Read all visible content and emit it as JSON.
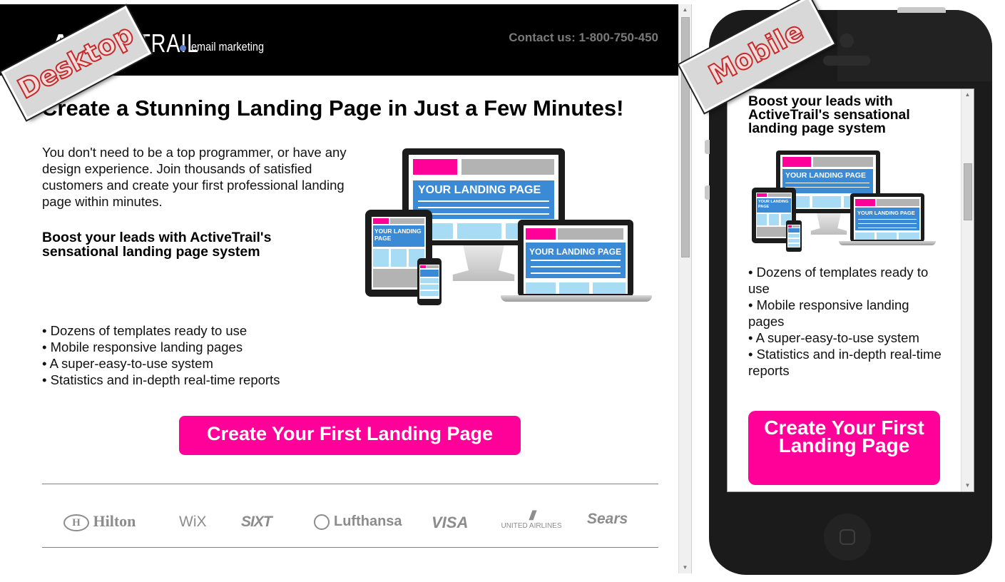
{
  "desktop": {
    "header": {
      "logo_bold": "AC",
      "logo_rest": "TIVETRAIL",
      "logo_visible_part": "RAIL",
      "logo_tagline": "email marketing",
      "contact": "Contact us: 1-800-750-450"
    },
    "title": "Create a Stunning Landing Page in Just a Few Minutes!",
    "intro": "You don't need to be a top programmer, or have any design experience. Join thousands of satisfied customers and create your first professional landing page within minutes.",
    "subheading": "Boost your leads with ActiveTrail's sensational landing page system",
    "bullets": [
      "• Dozens of templates ready to use",
      "• Mobile responsive landing pages",
      "• A super-easy-to-use system",
      "• Statistics and in-depth real-time reports"
    ],
    "cta_label": "Create Your First Landing Page",
    "brands": [
      "Hilton",
      "WiX",
      "SIXT",
      "Lufthansa",
      "VISA",
      "UNITED AIRLINES",
      "Sears"
    ],
    "scrollbar": {
      "up": "▲",
      "down": "▼"
    }
  },
  "illustration": {
    "screen_text": "YOUR LANDING PAGE",
    "tablet_text": "YOUR LANDING PAGE"
  },
  "mobile": {
    "subheading": "Boost your leads with ActiveTrail's sensational landing page system",
    "bullets": [
      "• Dozens of templates ready to use",
      "• Mobile responsive landing pages",
      "• A super-easy-to-use system",
      "• Statistics and in-depth real-time reports"
    ],
    "cta_label": "Create Your First Landing Page",
    "scrollbar": {
      "up": "▲",
      "down": "▼"
    }
  },
  "badges": {
    "desktop": "Desktop",
    "mobile": "Mobile"
  },
  "colors": {
    "accent": "#ff0099",
    "header_bg": "#000000",
    "illustration_blue": "#3b8ad6",
    "badge_text_outline": "#c42c2c"
  }
}
